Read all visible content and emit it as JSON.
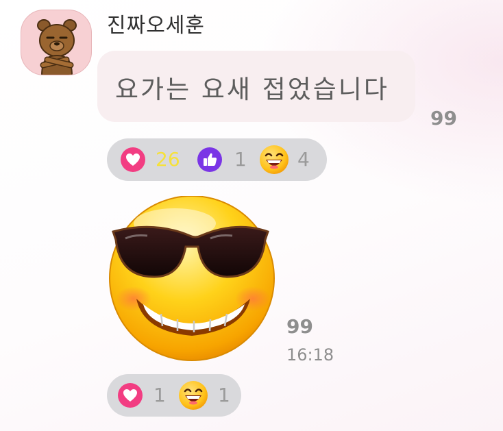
{
  "message1": {
    "sender_name": "진짜오세훈",
    "text": "요가는 요새 접었습니다",
    "unread_count": "99",
    "reactions": [
      {
        "icon": "heart-icon",
        "count": "26",
        "count_color": "#f6e13a"
      },
      {
        "icon": "thumbs-up-icon",
        "count": "1",
        "count_color": "#9a9a9a"
      },
      {
        "icon": "laughing-emoji-icon",
        "count": "4",
        "count_color": "#9a9a9a"
      }
    ]
  },
  "message2": {
    "sticker": "sunglasses-emoji-sticker",
    "unread_count": "99",
    "time": "16:18",
    "reactions": [
      {
        "icon": "heart-icon",
        "count": "1"
      },
      {
        "icon": "laughing-emoji-icon",
        "count": "1"
      }
    ]
  },
  "colors": {
    "heart": "#f23d82",
    "like": "#7a35e6",
    "reaction_bar": "#d9d9dc",
    "bubble": "#f8eef0",
    "avatar_bg": "#f7d0d3"
  }
}
